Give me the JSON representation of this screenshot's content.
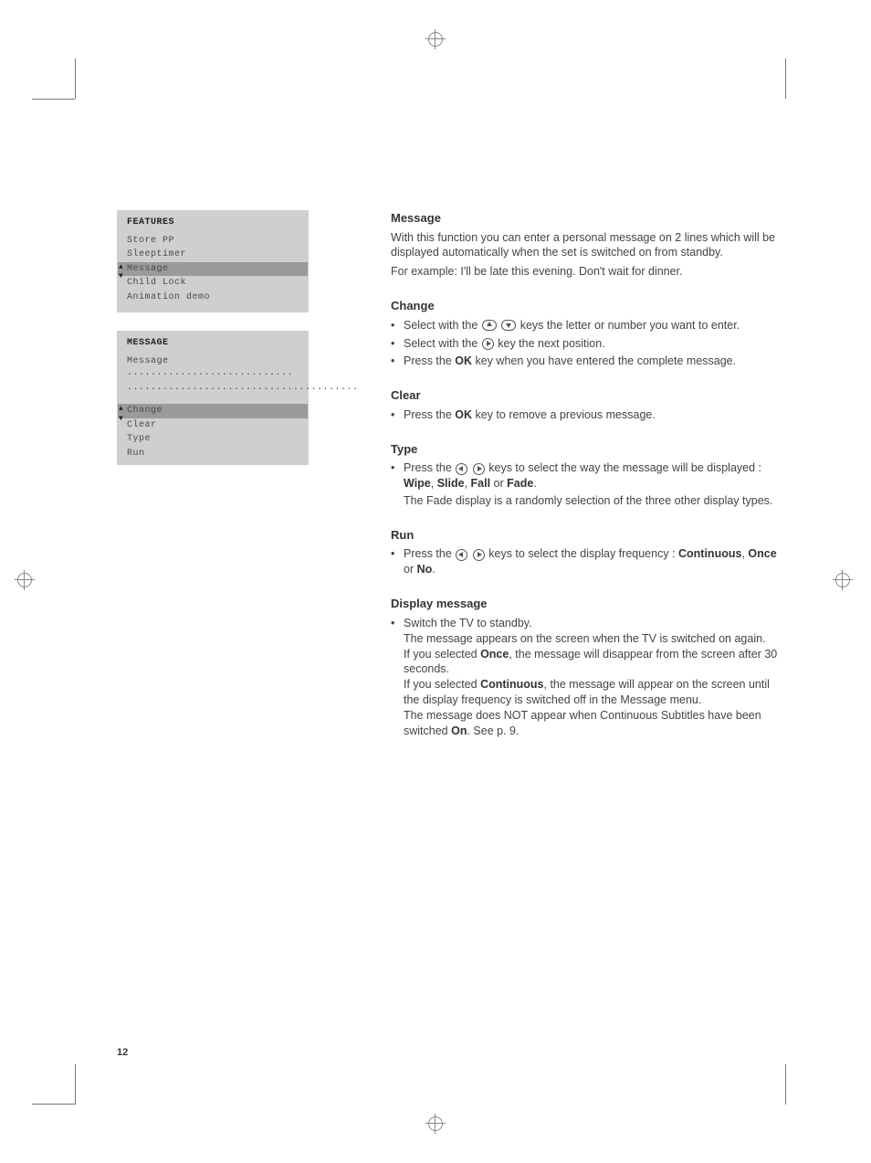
{
  "page_number": "12",
  "osd1": {
    "title": "FEATURES",
    "items": [
      "Store PP",
      "Sleeptimer",
      "Message",
      "Child Lock",
      "Animation demo"
    ],
    "selected_index": 2
  },
  "osd2": {
    "title": "MESSAGE",
    "msg_label": "Message",
    "msg_dots1": "............................",
    "msg_dots2": ".......................................",
    "items": [
      "Change",
      "Clear",
      "Type",
      "Run"
    ],
    "selected_index": 0
  },
  "s_message": {
    "h": "Message",
    "p1": "With this function you can enter a personal message on 2 lines which will be displayed automatically when the set is switched on from standby.",
    "p2": "For example:  I'll be late this evening. Don't wait for dinner."
  },
  "s_change": {
    "h": "Change",
    "b1a": "Select with the ",
    "b1b": " keys the letter or number you want to enter.",
    "b2a": "Select with the ",
    "b2b": " key the next position.",
    "b3a": "Press the ",
    "b3ok": "OK",
    "b3b": " key when you have entered the complete message."
  },
  "s_clear": {
    "h": "Clear",
    "b1a": "Press the ",
    "b1ok": "OK",
    "b1b": " key to remove a previous message."
  },
  "s_type": {
    "h": "Type",
    "b1a": "Press the ",
    "b1b": " keys to select the way the message will be displayed : ",
    "wipe": "Wipe",
    "sep1": ", ",
    "slide": "Slide",
    "sep2": ", ",
    "fall": "Fall",
    "sep3": " or ",
    "fade": "Fade",
    "dot": ".",
    "p2": "The Fade display is a randomly selection of the three other display types."
  },
  "s_run": {
    "h": "Run",
    "b1a": "Press the ",
    "b1b": " keys to select the display frequency : ",
    "cont": "Continuous",
    "sep1": ", ",
    "once": "Once",
    "sep2": " or ",
    "no": "No",
    "dot": "."
  },
  "s_disp": {
    "h": "Display message",
    "b1": "Switch the TV to standby.",
    "p1": "The message appears on the screen when the TV is switched on again.",
    "p2a": "If you selected ",
    "once": "Once",
    "p2b": ", the message will disappear from the screen after 30 seconds.",
    "p3a": "If you selected ",
    "cont": "Continuous",
    "p3b": ", the message will appear on the screen until the display frequency is switched off in the Message menu.",
    "p4a": "The message does NOT appear when Continuous Subtitles have been switched ",
    "on": "On",
    "p4b": ". See p. 9."
  }
}
